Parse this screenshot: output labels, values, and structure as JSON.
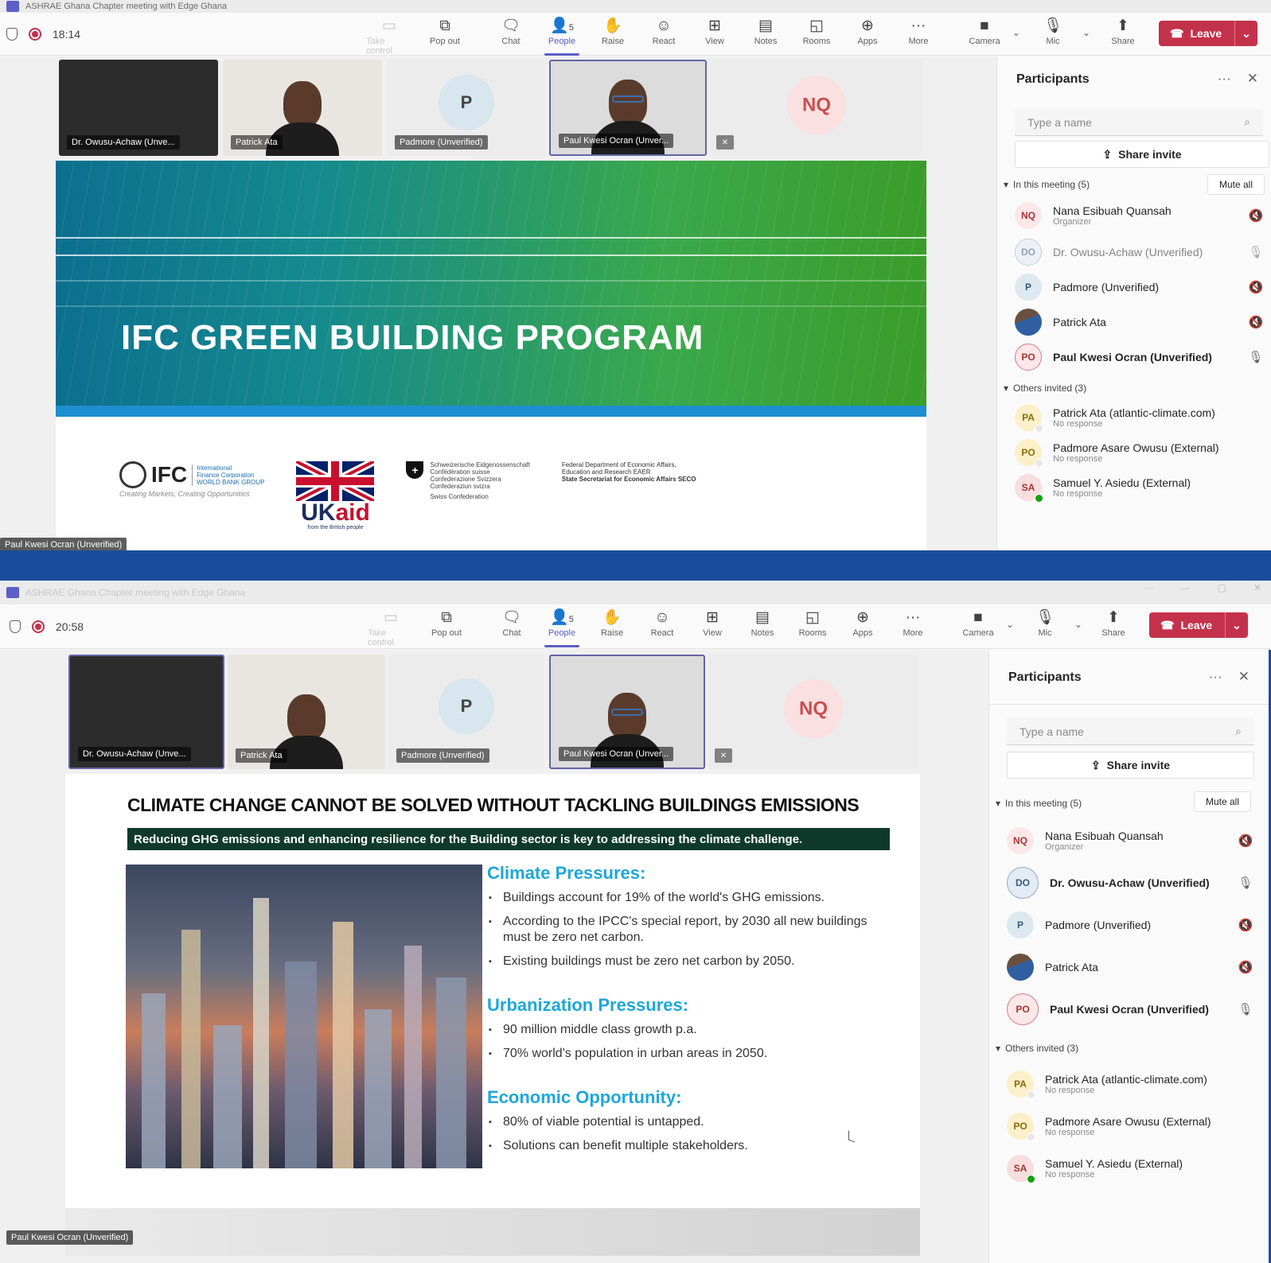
{
  "colors": {
    "brand": "#5b5fc7",
    "leave": "#c4314b",
    "background_band": "#1b4c9b",
    "slide_heading": "#1ea7d9"
  },
  "shots": [
    {
      "title": "ASHRAE Ghana Chapter meeting with Edge Ghana",
      "timer": "18:14",
      "toolbar": {
        "take_control": "Take control",
        "pop_out": "Pop out",
        "chat": "Chat",
        "people": "People",
        "people_count": "5",
        "raise": "Raise",
        "react": "React",
        "view": "View",
        "notes": "Notes",
        "rooms": "Rooms",
        "apps": "Apps",
        "more": "More",
        "camera": "Camera",
        "mic": "Mic",
        "share": "Share",
        "leave": "Leave"
      },
      "tiles": [
        "Dr. Owusu-Achaw (Unve...",
        "Patrick Ata",
        "Padmore (Unverified)",
        "Paul Kwesi Ocran (Unver..."
      ],
      "avatar_p": "P",
      "avatar_nq": "NQ",
      "slide": {
        "title": "IFC GREEN BUILDING PROGRAM",
        "ifc_word": "IFC",
        "ifc_sub": [
          "International",
          "Finance Corporation",
          "WORLD BANK GROUP"
        ],
        "ifc_tag": "Creating Markets, Creating Opportunities",
        "ukaid_main": "UK",
        "ukaid_accent": "aid",
        "ukaid_sub": "from the British people",
        "swiss": [
          "Schweizerische Eidgenossenschaft",
          "Confédération suisse",
          "Confederazione Svizzera",
          "Confederaziun svizra",
          "Swiss Confederation"
        ],
        "seco": [
          "Federal Department of Economic Affairs,",
          "Education and Research EAER",
          "State Secretariat for Economic Affairs SECO"
        ]
      },
      "speaker": "Paul Kwesi Ocran (Unverified)"
    },
    {
      "title": "ASHRAE Ghana Chapter meeting with Edge Ghana",
      "timer": "20:58",
      "toolbar": {
        "take_control": "Take control",
        "pop_out": "Pop out",
        "chat": "Chat",
        "people": "People",
        "people_count": "5",
        "raise": "Raise",
        "react": "React",
        "view": "View",
        "notes": "Notes",
        "rooms": "Rooms",
        "apps": "Apps",
        "more": "More",
        "camera": "Camera",
        "mic": "Mic",
        "share": "Share",
        "leave": "Leave"
      },
      "tiles": [
        "Dr. Owusu-Achaw (Unve...",
        "Patrick Ata",
        "Padmore (Unverified)",
        "Paul Kwesi Ocran (Unver..."
      ],
      "avatar_p": "P",
      "avatar_nq": "NQ",
      "slide": {
        "title": "CLIMATE CHANGE CANNOT BE SOLVED WITHOUT TACKLING BUILDINGS EMISSIONS",
        "subtitle": "Reducing GHG emissions and enhancing resilience for the Building sector is key to addressing the climate challenge.",
        "sections": [
          {
            "heading": "Climate Pressures:",
            "items": [
              "Buildings account for 19% of the world's GHG emissions.",
              "According to the IPCC's special report, by 2030 all new buildings must be zero net carbon.",
              "Existing buildings must be zero net carbon by 2050."
            ]
          },
          {
            "heading": "Urbanization Pressures:",
            "items": [
              "90 million middle class growth p.a.",
              "70% world's population in urban areas in 2050."
            ]
          },
          {
            "heading": "Economic Opportunity:",
            "items": [
              "80% of viable potential is untapped.",
              "Solutions can benefit multiple stakeholders."
            ]
          }
        ]
      },
      "speaker": "Paul Kwesi Ocran (Unverified)"
    }
  ],
  "panel": {
    "title": "Participants",
    "search_placeholder": "Type a name",
    "share_invite": "Share invite",
    "in_meeting": "In this meeting (5)",
    "mute_all": "Mute all",
    "others": "Others invited (3)",
    "members": [
      {
        "initials": "NQ",
        "name": "Nana Esibuah Quansah",
        "sub": "Organizer"
      },
      {
        "initials": "DO",
        "name": "Dr. Owusu-Achaw (Unverified)",
        "sub": ""
      },
      {
        "initials": "P",
        "name": "Padmore (Unverified)",
        "sub": ""
      },
      {
        "initials": "",
        "name": "Patrick Ata",
        "sub": ""
      },
      {
        "initials": "PO",
        "name": "Paul Kwesi Ocran (Unverified)",
        "sub": ""
      }
    ],
    "invited": [
      {
        "initials": "PA",
        "name": "Patrick Ata (atlantic-climate.com)",
        "sub": "No response"
      },
      {
        "initials": "PO",
        "name": "Padmore Asare Owusu (External)",
        "sub": "No response"
      },
      {
        "initials": "SA",
        "name": "Samuel Y. Asiedu (External)",
        "sub": "No response"
      }
    ]
  }
}
